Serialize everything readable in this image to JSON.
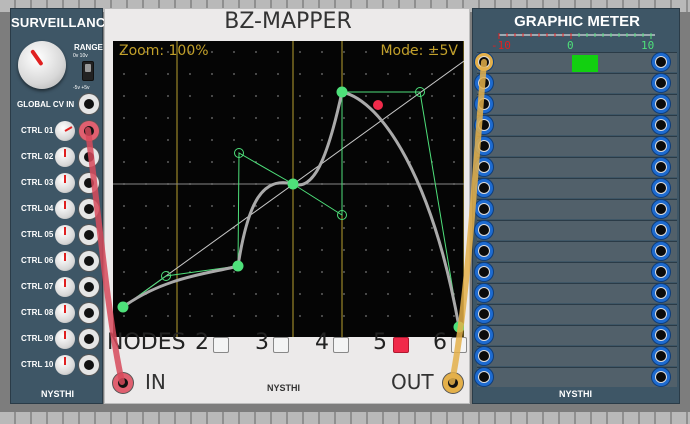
{
  "surveillance": {
    "title": "SURVEILLANCE",
    "range_label": "RANGE",
    "range_top": "0v 10v",
    "range_bottom": "-5v +5v",
    "global_cv": "GLOBAL CV IN",
    "ctrl": [
      "CTRL 01",
      "CTRL 02",
      "CTRL 03",
      "CTRL 04",
      "CTRL 05",
      "CTRL 06",
      "CTRL 07",
      "CTRL 08",
      "CTRL 09",
      "CTRL 10"
    ],
    "brand": "NYSTHI"
  },
  "bz": {
    "title": "BZ-MAPPER",
    "zoom": "Zoom: 100%",
    "mode": "Mode: ±5V",
    "nodes_label": "NODES",
    "nodes": [
      "2",
      "3",
      "4",
      "5",
      "6"
    ],
    "selected_node": "5",
    "in_label": "IN",
    "out_label": "OUT",
    "brand": "NYSTHI"
  },
  "meter": {
    "title": "GRAPHIC METER",
    "scale": [
      "-10",
      "0",
      "10"
    ],
    "brand": "NYSTHI"
  },
  "colors": {
    "panel": "#3e5666",
    "node": "#4ee07a",
    "accent": "#f02a4a",
    "gold": "#c2a02a"
  }
}
